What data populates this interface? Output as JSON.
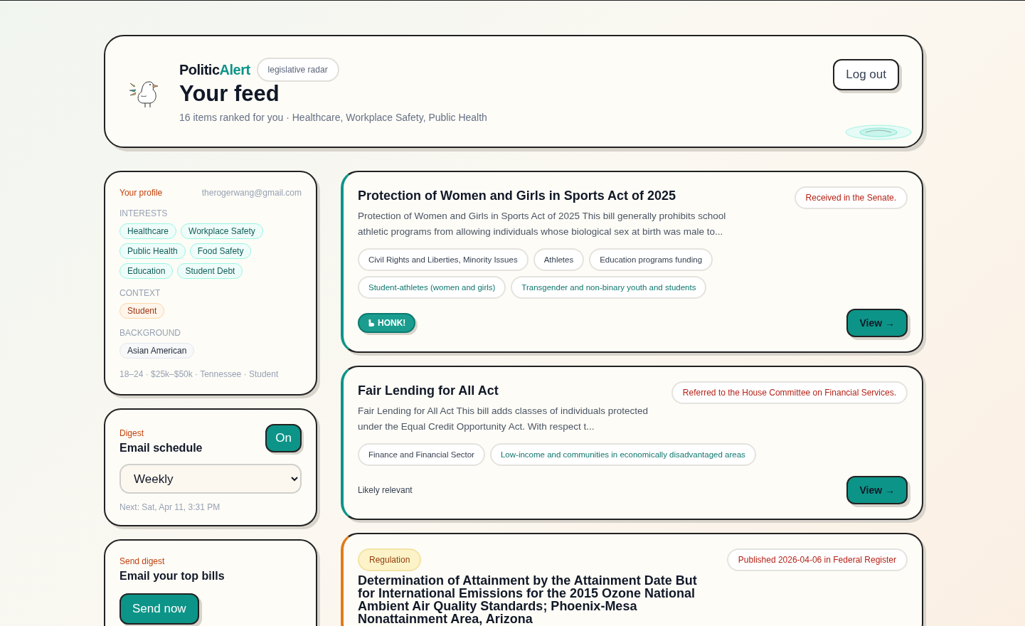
{
  "header": {
    "brand": {
      "name": "Politic",
      "accent": "Alert"
    },
    "badge": "legislative radar",
    "title": "Your feed",
    "subtitle": "16 items ranked for you · Healthcare, Workplace Safety, Public Health",
    "logout": "Log out"
  },
  "profile": {
    "label": "Your profile",
    "email": "therogerwang@gmail.com",
    "sections": [
      {
        "heading": "INTERESTS",
        "kind": "interest",
        "tags": [
          "Healthcare",
          "Workplace Safety",
          "Public Health",
          "Food Safety",
          "Education",
          "Student Debt"
        ]
      },
      {
        "heading": "CONTEXT",
        "kind": "context",
        "tags": [
          "Student"
        ]
      },
      {
        "heading": "BACKGROUND",
        "kind": "background",
        "tags": [
          "Asian American"
        ]
      }
    ],
    "summary": "18–24 · $25k–$50k · Tennessee · Student"
  },
  "digest": {
    "label": "Digest",
    "title": "Email schedule",
    "on": true,
    "toggle": "On",
    "frequency": "Weekly",
    "next": "Next: Sat, Apr 11, 3:31 PM"
  },
  "send": {
    "label": "Send digest",
    "title": "Email your top bills",
    "button": "Send now"
  },
  "feed": [
    {
      "kind": "bill",
      "title": "Protection of Women and Girls in Sports Act of 2025",
      "status": "Received in the Senate.",
      "summary": "Protection of Women and Girls in Sports Act of 2025 This bill generally prohibits school athletic programs from allowing individuals whose biological sex at birth was male to...",
      "tags": [
        {
          "label": "Civil Rights and Liberties, Minority Issues",
          "match": false
        },
        {
          "label": "Athletes",
          "match": false
        },
        {
          "label": "Education programs funding",
          "match": false
        },
        {
          "label": "Student-athletes (women and girls)",
          "match": true
        },
        {
          "label": "Transgender and non-binary youth and students",
          "match": true
        }
      ],
      "footer": {
        "kind": "honk",
        "text": "HONK!"
      },
      "view": "View →"
    },
    {
      "kind": "bill",
      "title": "Fair Lending for All Act",
      "status": "Referred to the House Committee on Financial Services.",
      "summary": "Fair Lending for All Act This bill adds classes of individuals protected under the Equal Credit Opportunity Act. With respect t...",
      "tags": [
        {
          "label": "Finance and Financial Sector",
          "match": false
        },
        {
          "label": "Low-income and communities in economically disadvantaged areas",
          "match": true
        }
      ],
      "footer": {
        "kind": "note",
        "text": "Likely relevant"
      },
      "view": "View →"
    },
    {
      "kind": "regulation",
      "type_label": "Regulation",
      "title": "Determination of Attainment by the Attainment Date But for International Emissions for the 2015 Ozone National Ambient Air Quality Standards; Phoenix-Mesa Nonattainment Area, Arizona",
      "status": "Published 2026-04-06 in Federal Register"
    }
  ]
}
